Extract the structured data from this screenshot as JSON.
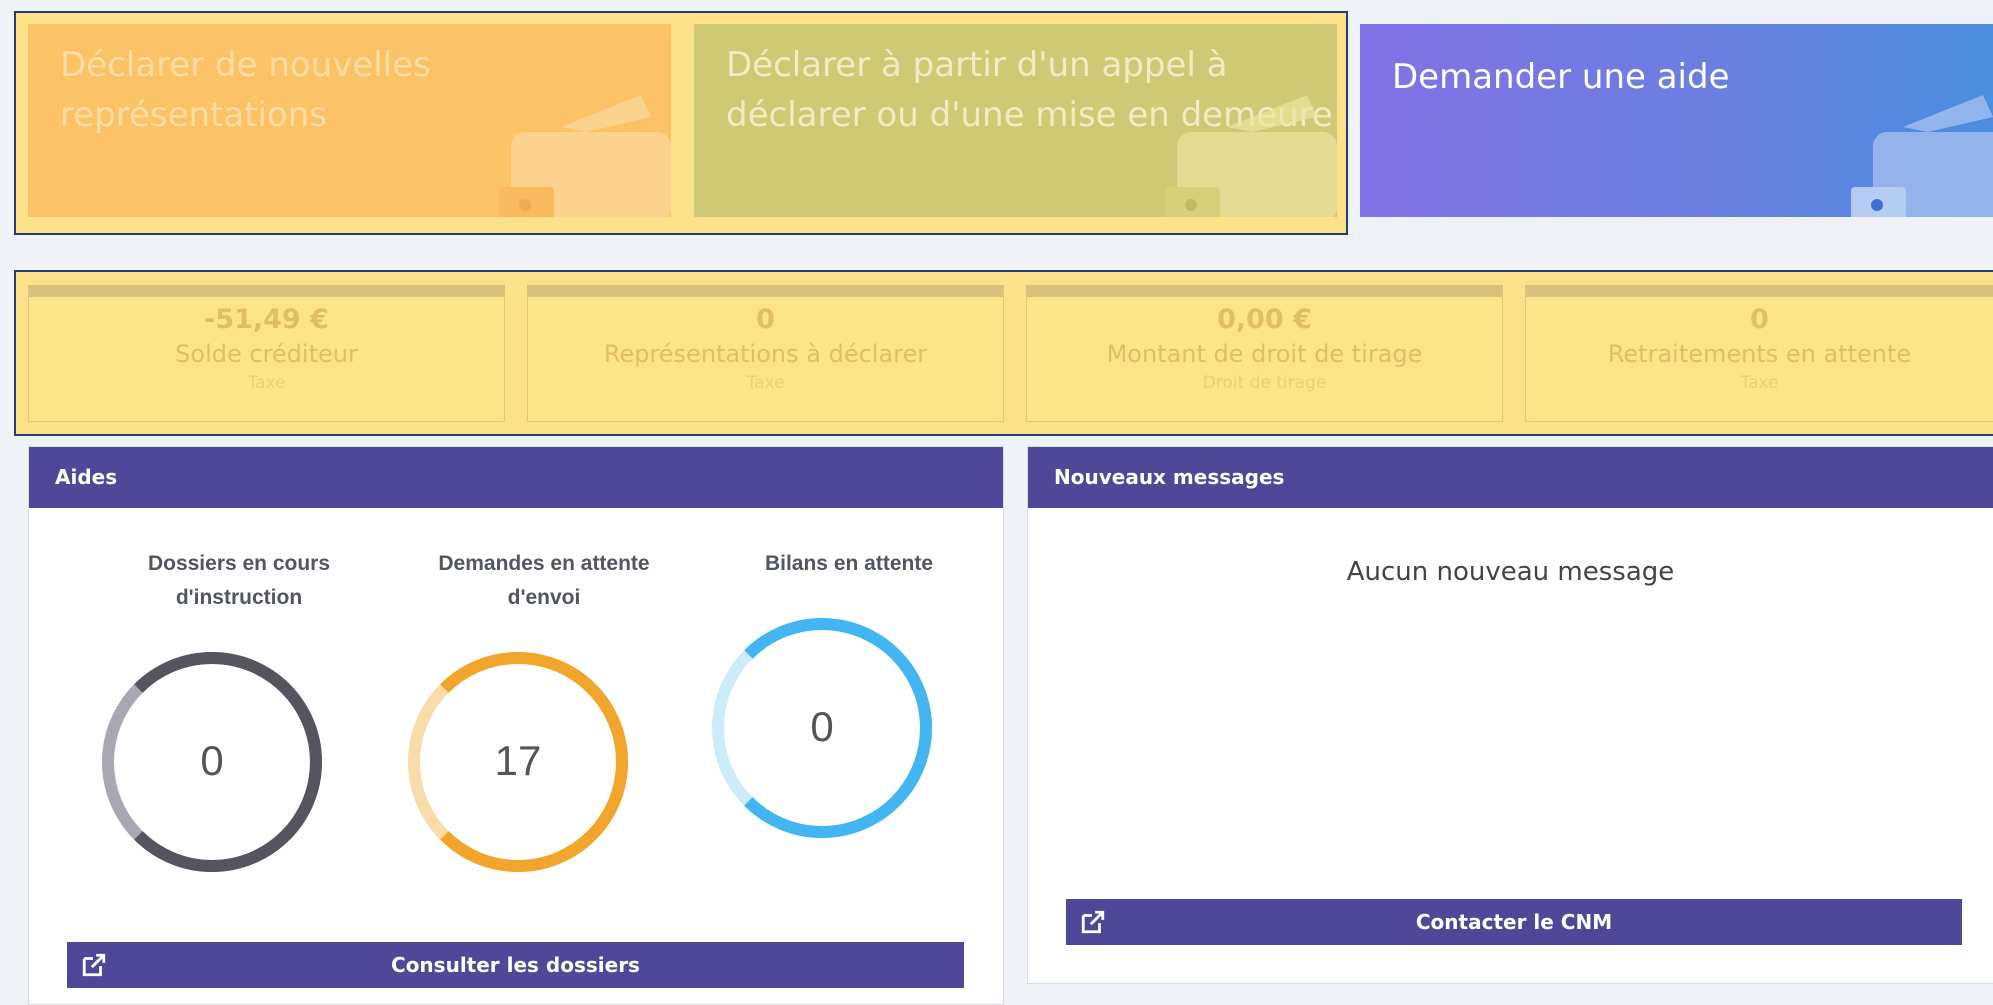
{
  "tiles": [
    {
      "line1": "Déclarer de nouvelles",
      "line2": "représentations"
    },
    {
      "line1": "Déclarer à partir d'un appel à",
      "line2": "déclarer ou d'une mise en demeure"
    },
    {
      "line1": "Demander une aide",
      "line2": ""
    }
  ],
  "stats": [
    {
      "value": "-51,49 €",
      "label": "Solde créditeur",
      "sub": "Taxe"
    },
    {
      "value": "0",
      "label": "Représentations à déclarer",
      "sub": "Taxe"
    },
    {
      "value": "0,00 €",
      "label": "Montant de droit de tirage",
      "sub": "Droit de tirage"
    },
    {
      "value": "0",
      "label": "Retraitements en attente",
      "sub": "Taxe"
    }
  ],
  "aides": {
    "title": "Aides",
    "gauges": [
      {
        "label_line1": "Dossiers en cours",
        "label_line2": "d'instruction",
        "value": "0",
        "fill": 0.75,
        "color": "#55545f",
        "track": "#a8a7b2"
      },
      {
        "label_line1": "Demandes en attente",
        "label_line2": "d'envoi",
        "value": "17",
        "fill": 0.75,
        "color": "#f1a52a",
        "track": "#f9dca9"
      },
      {
        "label_line1": "Bilans en attente",
        "label_line2": "",
        "value": "0",
        "fill": 0.75,
        "color": "#43b6f1",
        "track": "#cdebfb"
      }
    ],
    "button_label": "Consulter les dossiers"
  },
  "messages": {
    "title": "Nouveaux messages",
    "empty_text": "Aucun nouveau message",
    "button_label": "Contacter le CNM"
  },
  "icons": {
    "tile": "wallet-icon",
    "button": "external-link-icon"
  }
}
